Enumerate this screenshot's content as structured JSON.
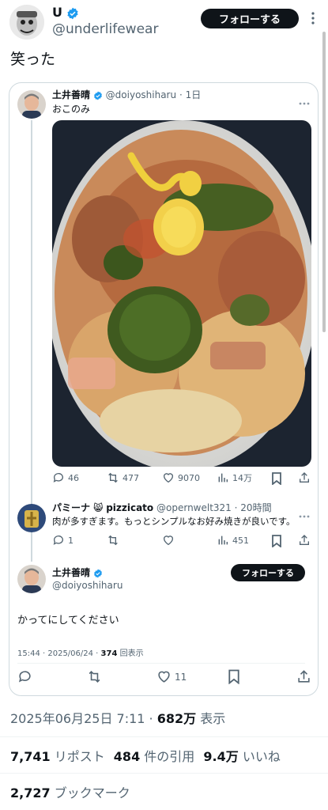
{
  "main": {
    "display_name": "U",
    "handle": "@underlifewear",
    "follow_label": "フォローする",
    "text": "笑った"
  },
  "quote": {
    "name": "土井善晴",
    "handle": "@doiyoshiharu",
    "time": "1日",
    "text": "おこのみ",
    "stats": {
      "replies": "46",
      "reposts": "477",
      "likes": "9070",
      "views": "14万"
    }
  },
  "reply": {
    "name": "パミーナ",
    "name_rest": "pizzicato",
    "handle": "@opernwelt321",
    "time": "20時間",
    "text": "肉が多すぎます。もっとシンプルなお好み焼きが良いです。",
    "stats": {
      "replies": "1",
      "views": "451"
    }
  },
  "focus": {
    "name": "土井善晴",
    "handle": "@doiyoshiharu",
    "follow_label": "フォローする",
    "text": "かってにしてください",
    "time": "15:44 · 2025/06/24 · ",
    "views_num": "374",
    "views_label": " 回表示",
    "likes": "11"
  },
  "meta": {
    "date": "2025年06月25日 7:11 · ",
    "views_num": "682万",
    "views_label": " 表示"
  },
  "engagement": {
    "reposts_num": "7,741",
    "reposts_label": " リポスト",
    "quotes_num": "484",
    "quotes_label": " 件の引用",
    "likes_num": "9.4万",
    "likes_label": " いいね",
    "bookmarks_num": "2,727",
    "bookmarks_label": " ブックマーク"
  },
  "colors": {
    "accent": "#1d9bf0",
    "text": "#0f1419",
    "muted": "#536471",
    "border": "#cfd9de"
  }
}
